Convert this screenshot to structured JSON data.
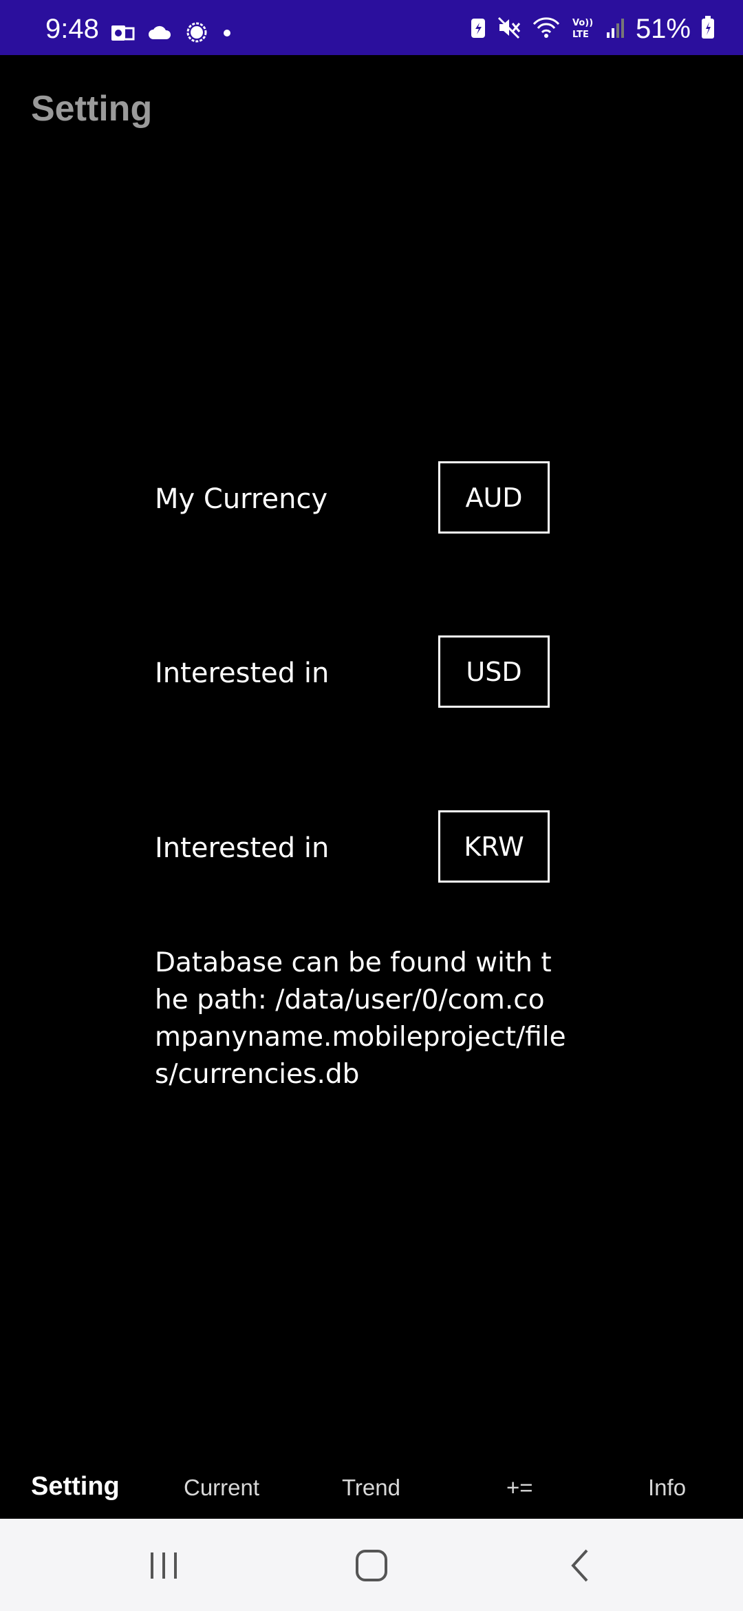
{
  "status_bar": {
    "time": "9:48",
    "battery_percent": "51%",
    "bg_color": "#2b0f9d",
    "left_icons": [
      "outlook-icon",
      "cloud-icon",
      "signal-messenger-icon",
      "dot-icon"
    ],
    "right_icons": [
      "battery-saver-icon",
      "mute-icon",
      "wifi-icon",
      "volte-icon",
      "signal-bars-icon",
      "battery-icon"
    ]
  },
  "header": {
    "title": "Setting"
  },
  "settings": {
    "rows": [
      {
        "label": "My Currency",
        "value": "AUD"
      },
      {
        "label": "Interested in",
        "value": "USD"
      },
      {
        "label": "Interested in",
        "value": "KRW"
      }
    ],
    "db_note": "Database can be found with the path: /data/user/0/com.companyname.mobileproject/files/currencies.db"
  },
  "bottom_nav": {
    "items": [
      {
        "label": "Setting",
        "active": true
      },
      {
        "label": "Current",
        "active": false
      },
      {
        "label": "Trend",
        "active": false
      },
      {
        "label": "+=",
        "active": false
      },
      {
        "label": "Info",
        "active": false
      }
    ]
  },
  "system_nav": {
    "icons": [
      "recents-icon",
      "home-icon",
      "back-icon"
    ]
  }
}
